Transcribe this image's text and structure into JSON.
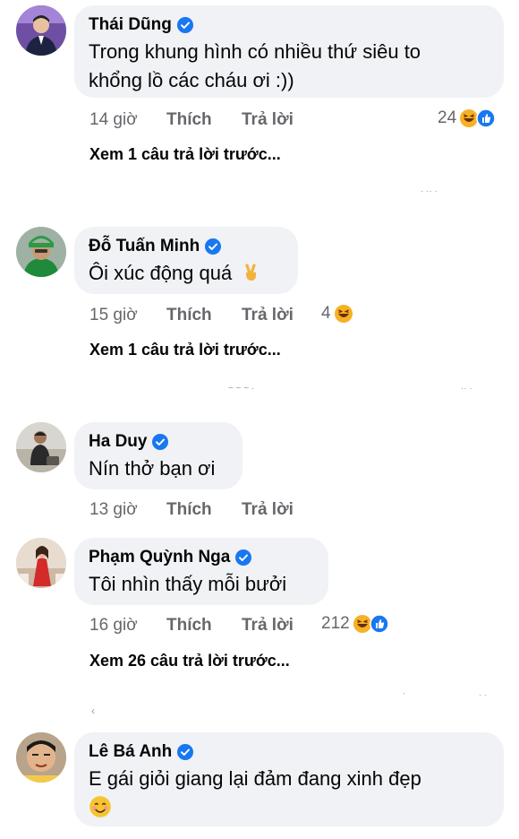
{
  "comments": [
    {
      "name": "Thái Dũng",
      "text_line1": "Trong khung hình có nhiều thứ siêu to",
      "text_line2": "khổng lồ các cháu ơi :))",
      "time": "14 giờ",
      "like": "Thích",
      "reply": "Trả lời",
      "reaction_count": "24",
      "view_replies": "Xem 1 câu trả lời trước..."
    },
    {
      "name": "Đỗ Tuấn Minh",
      "text": "Ôi xúc động quá",
      "time": "15 giờ",
      "like": "Thích",
      "reply": "Trả lời",
      "reaction_count": "4",
      "view_replies": "Xem 1 câu trả lời trước..."
    },
    {
      "name": "Ha Duy",
      "text": "Nín thở bạn ơi",
      "time": "13 giờ",
      "like": "Thích",
      "reply": "Trả lời"
    },
    {
      "name": "Phạm Quỳnh Nga",
      "text": "Tôi nhìn thấy mỗi bưởi",
      "time": "16 giờ",
      "like": "Thích",
      "reply": "Trả lời",
      "reaction_count": "212",
      "view_replies": "Xem 26 câu trả lời trước..."
    },
    {
      "name": "Lê Bá Anh",
      "text": "E gái giỏi giang lại đảm đang xinh đẹp"
    }
  ],
  "colors": {
    "bubble": "#f0f2f5",
    "meta_gray": "#65676b",
    "verified_blue": "#1877f2",
    "haha_yellow": "#f7b125"
  },
  "icons": [
    "verified-badge-icon",
    "haha-reaction-icon",
    "like-reaction-icon",
    "victory-hand-emoji-icon",
    "smiling-face-emoji-icon"
  ]
}
